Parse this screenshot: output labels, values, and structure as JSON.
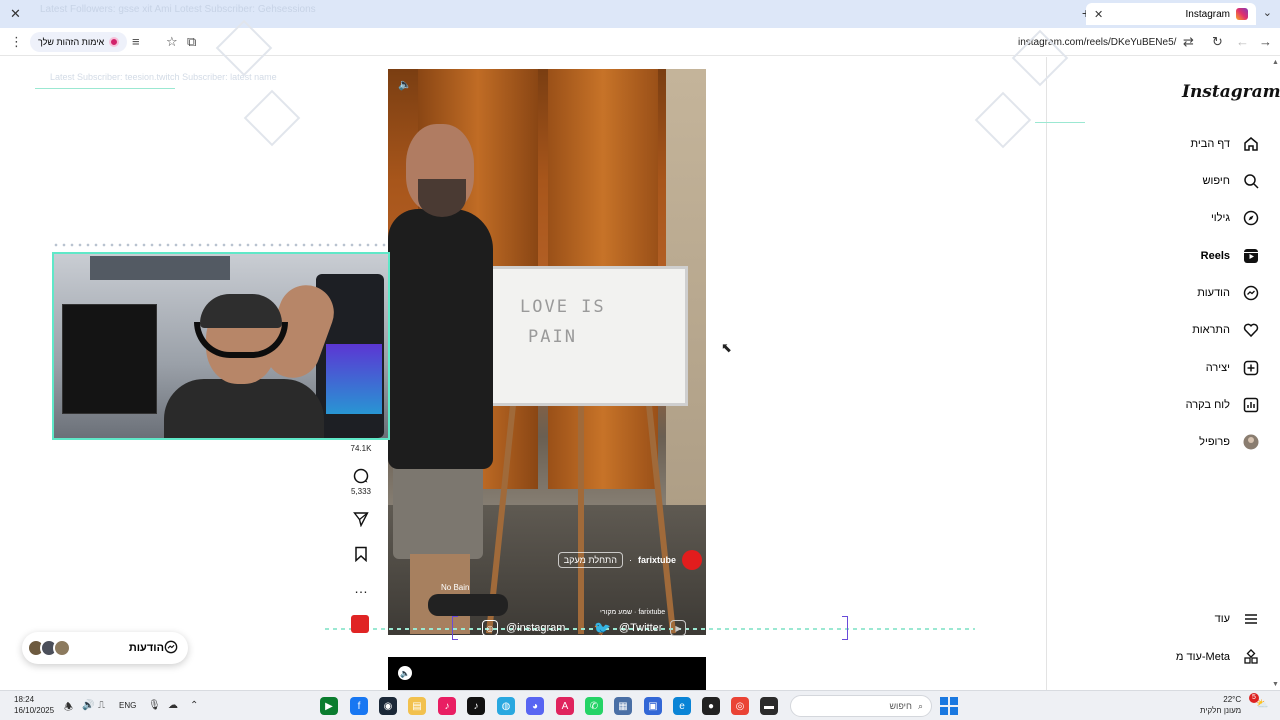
{
  "browser": {
    "tab_title": "Instagram",
    "tab_ghost_text": "Latest Followers: gsse xit Ami  Lotest Subscriber: Gehsessions",
    "address": "instagram.com/reels/DKeYuBENe5/",
    "identity_label": "אימות הזהות שלך"
  },
  "sidebar": {
    "logo": "Instagram",
    "items": [
      {
        "label": "דף הבית",
        "icon": "home-icon"
      },
      {
        "label": "חיפוש",
        "icon": "search-icon"
      },
      {
        "label": "גילוי",
        "icon": "explore-icon"
      },
      {
        "label": "Reels",
        "icon": "reels-icon"
      },
      {
        "label": "הודעות",
        "icon": "messenger-icon"
      },
      {
        "label": "התראות",
        "icon": "heart-icon"
      },
      {
        "label": "יצירה",
        "icon": "plus-square-icon"
      },
      {
        "label": "לוח בקרה",
        "icon": "dashboard-icon"
      },
      {
        "label": "פרופיל",
        "icon": "avatar-icon"
      }
    ],
    "more": "עוד",
    "meta": "עוד מ-Meta"
  },
  "reel": {
    "username": "farixtube",
    "follow": "התחלת מעקב",
    "board_line1": "LOVE IS",
    "board_line2": "PAIN",
    "caption": "No Bain",
    "audio": "farixtube · שמע מקורי"
  },
  "actions": {
    "likes": "74.1K",
    "comments": "5,333",
    "more": "…"
  },
  "overlay": {
    "ghost_top": "Latest Subscriber: teesion.twitch  Subscriber: latest name",
    "instagram": "@instagram",
    "twitter": "@Twitter"
  },
  "messages_pill": {
    "label": "הודעות"
  },
  "taskbar": {
    "time": "18:24",
    "date": "16/10/2025",
    "lang": "ENG",
    "search": "חיפוש",
    "temp": "22°C",
    "weather": "מעונן חלקית",
    "badge": "5"
  },
  "colors": {
    "accent": "#5fe8c8",
    "live_red": "#e02424"
  }
}
